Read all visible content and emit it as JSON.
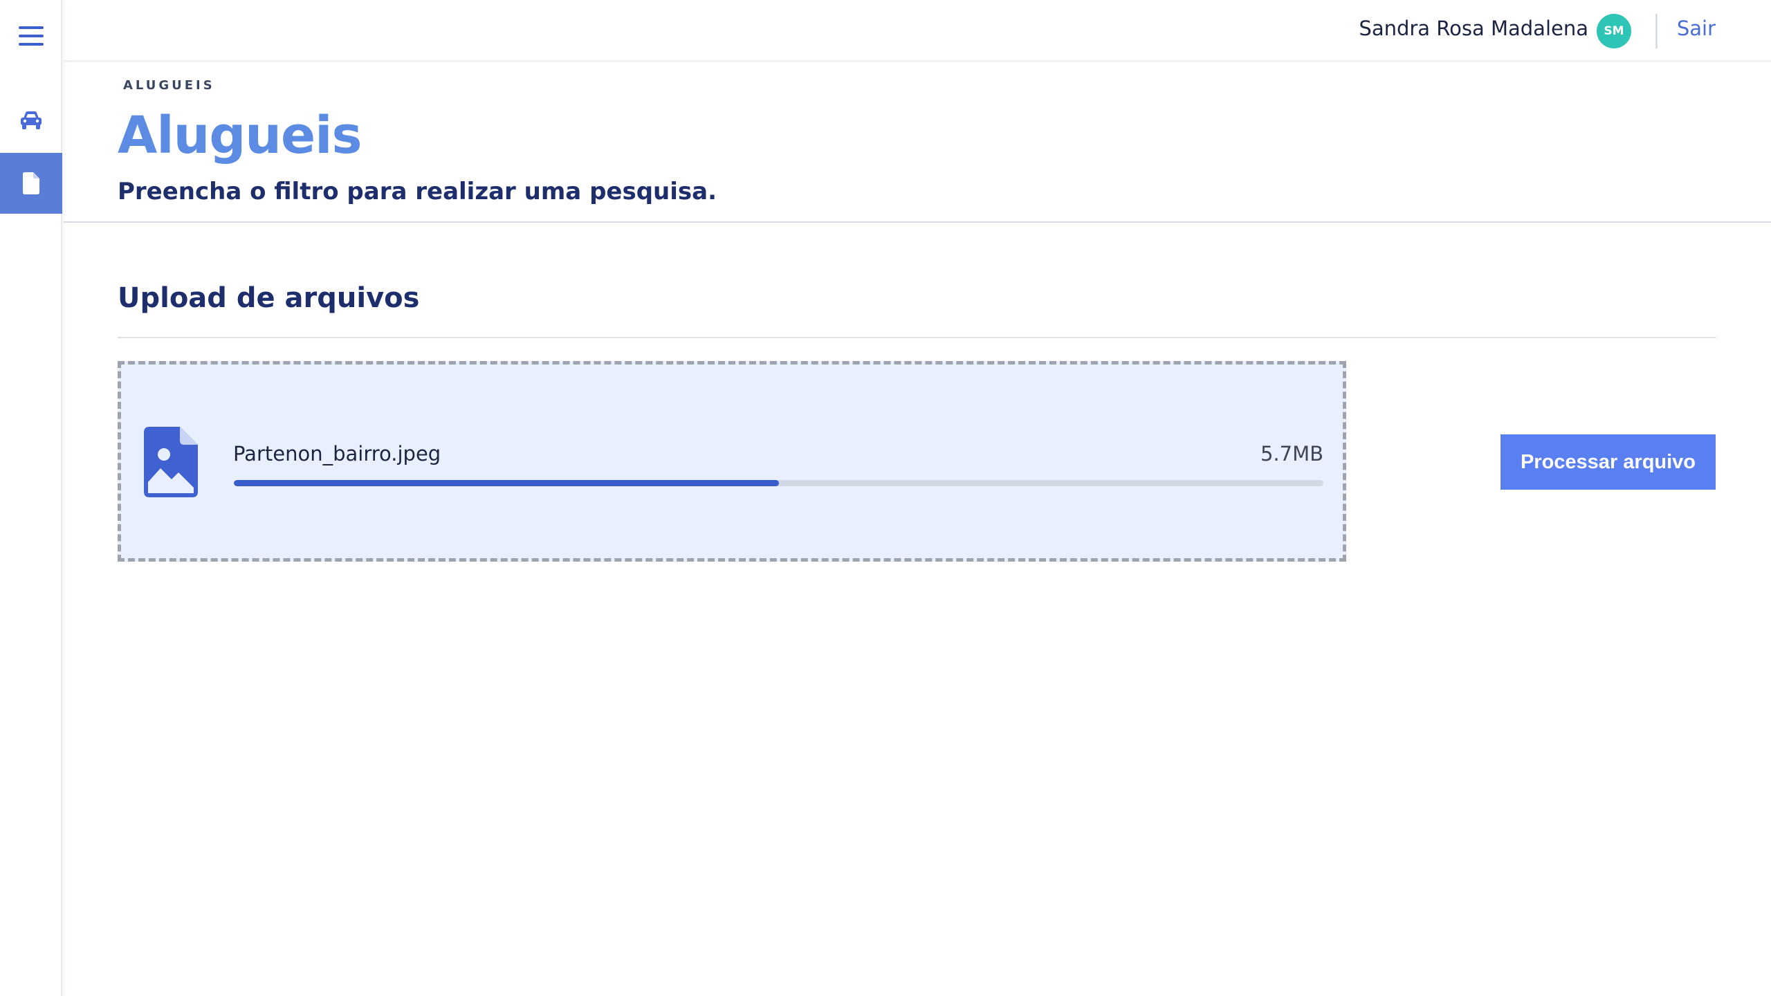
{
  "user": {
    "name": "Sandra Rosa Madalena",
    "initials": "SM",
    "logout_label": "Sair"
  },
  "sidebar": {
    "items": [
      {
        "icon": "menu-icon"
      },
      {
        "icon": "car-icon"
      },
      {
        "icon": "document-icon",
        "active": true
      }
    ]
  },
  "header": {
    "breadcrumb": "ALUGUEIS",
    "title": "Alugueis",
    "subtitle": "Preencha o filtro para realizar uma pesquisa."
  },
  "upload": {
    "section_title": "Upload de arquivos",
    "file": {
      "icon": "image-file-icon",
      "name": "Partenon_bairro.jpeg",
      "size": "5.7MB",
      "progress": 0.5
    },
    "process_button_label": "Processar arquivo"
  },
  "colors": {
    "accent": "#5b8be2",
    "primary_button": "#5a7ff0",
    "progress_fill": "#3a5ccc",
    "avatar": "#2ec4b6",
    "dropzone_bg": "#e9f0fd",
    "sidebar_active": "#5a7ed8"
  }
}
